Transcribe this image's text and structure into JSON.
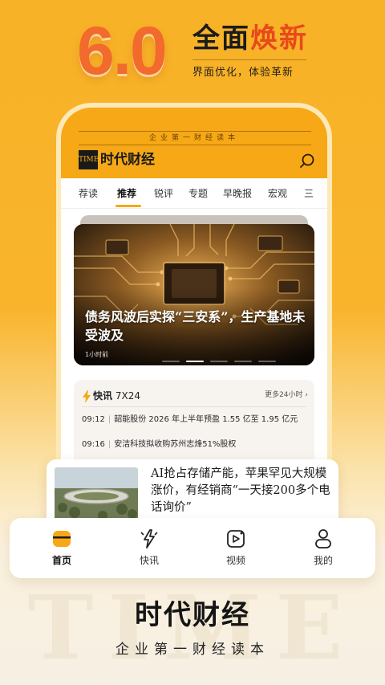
{
  "promo": {
    "version": "6.0",
    "headline_dark": "全面",
    "headline_accent": "焕新",
    "subline": "界面优化，体验革新"
  },
  "app": {
    "tagline": "企业第一财经读本",
    "logo_mark": "TIME",
    "logo_text": "时代财经",
    "search_icon": "search-icon"
  },
  "tabs": [
    {
      "label": "荐读"
    },
    {
      "label": "推荐",
      "active": true
    },
    {
      "label": "锐评"
    },
    {
      "label": "专题"
    },
    {
      "label": "早晚报"
    },
    {
      "label": "宏观"
    },
    {
      "label": "三"
    }
  ],
  "banner": {
    "title": "债务风波后实探“三安系”，生产基地未受波及",
    "time": "1小时前",
    "slide_count": 5,
    "active_slide": 2
  },
  "flash": {
    "title_prefix": "快讯",
    "title_suffix": "7X24",
    "more": "更多24小时 ›",
    "items": [
      {
        "time": "09:12",
        "text": "韶能股份 2026 年上半年预盈 1.55 亿至 1.95 亿元"
      },
      {
        "time": "09:16",
        "text": "安洁科技拟收购苏州志烽51%股权"
      }
    ]
  },
  "article": {
    "title": "AI抢占存储产能，苹果罕见大规模涨价，有经销商“一天接200多个电话询价”"
  },
  "bottom_nav": [
    {
      "label": "首页",
      "icon": "home-icon",
      "active": true
    },
    {
      "label": "快讯",
      "icon": "flash-icon"
    },
    {
      "label": "视频",
      "icon": "video-icon"
    },
    {
      "label": "我的",
      "icon": "profile-icon"
    }
  ],
  "footer": {
    "watermark": "TIME",
    "brand": "时代财经",
    "slogan": "企业第一财经读本"
  },
  "colors": {
    "accent": "#f6a816",
    "version_orange": "#f26a2c",
    "headline_red": "#e8491b"
  }
}
